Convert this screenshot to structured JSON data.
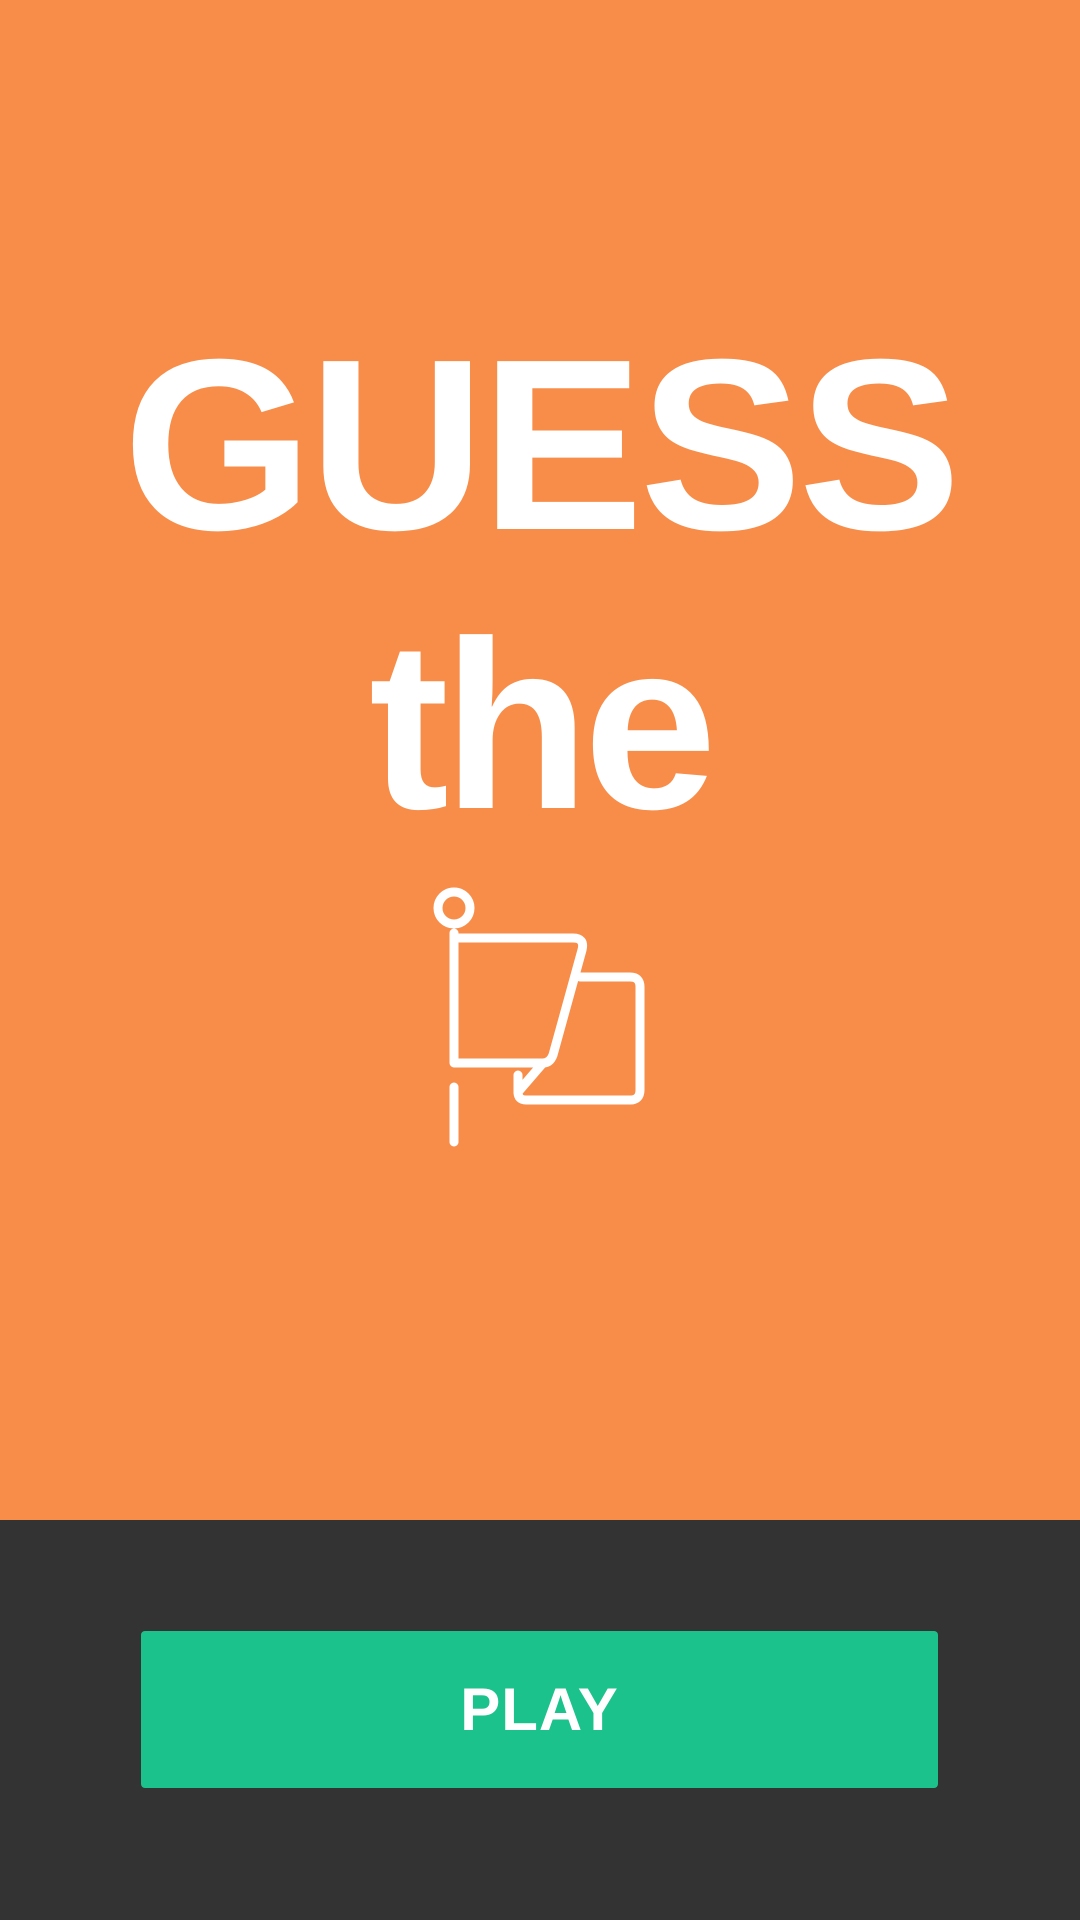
{
  "title": {
    "line1": "GUESS",
    "line2": "the",
    "icon": "flag-icon"
  },
  "play_button": {
    "label": "PLAY"
  },
  "colors": {
    "title_background": "#F88D49",
    "control_background": "#333333",
    "play_button": "#1CC28B",
    "text": "#FFFFFF"
  }
}
